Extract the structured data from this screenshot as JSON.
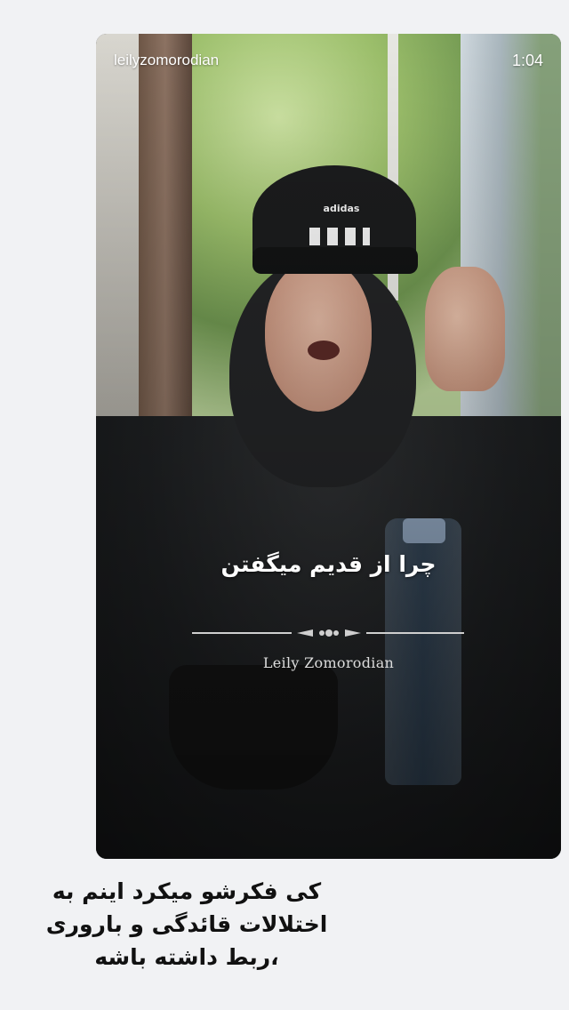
{
  "story": {
    "username": "leilyzomorodian",
    "timestamp": "1:04"
  },
  "video": {
    "subtitle": "چرا از قدیم میگفتن",
    "watermark": "Leily Zomorodian",
    "cap_brand": "adidas"
  },
  "caption": {
    "text": "کی فکرشو میکرد اینم به اختلالات قائدگی و باروری ،ربط داشته باشه"
  }
}
